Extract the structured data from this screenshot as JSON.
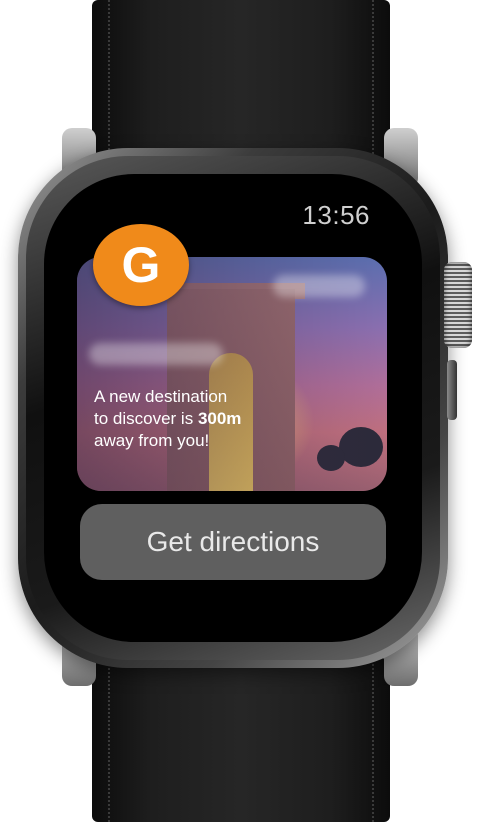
{
  "screen": {
    "time": "13:56",
    "notification": {
      "logo_letter": "G",
      "message_line1": "A new destination",
      "message_line2_prefix": "to discover is ",
      "distance": "300m",
      "message_line3": "away from you!"
    },
    "action_button_label": "Get directions"
  },
  "colors": {
    "logo_background": "#f08a1a",
    "button_background": "#5f5f5f",
    "screen_background": "#000000"
  }
}
